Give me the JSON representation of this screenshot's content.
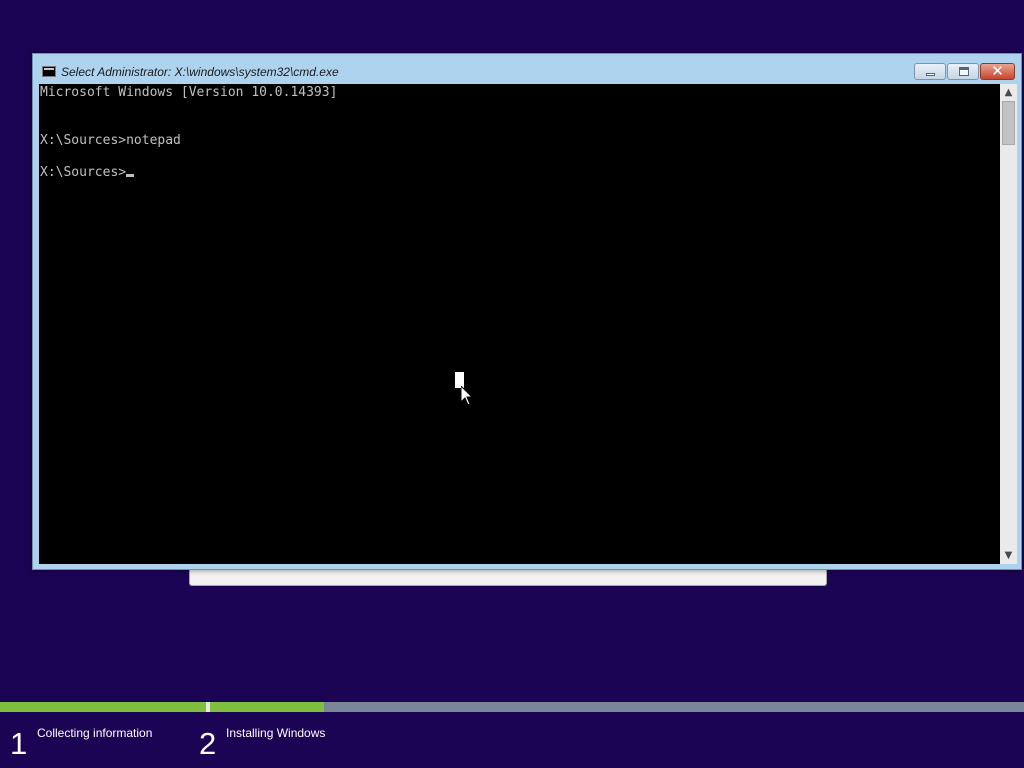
{
  "window": {
    "title": "Select Administrator: X:\\windows\\system32\\cmd.exe",
    "icon": "cmd-icon",
    "controls": {
      "minimize": "minimize-icon",
      "maximize": "maximize-icon",
      "close_symbol": "✕"
    }
  },
  "console": {
    "lines": [
      "Microsoft Windows [Version 10.0.14393]",
      "X:\\Sources>notepad",
      "X:\\Sources>"
    ],
    "text_color": "#c0c0c0",
    "background": "#000000"
  },
  "scrollbar": {
    "up_symbol": "▲",
    "down_symbol": "▼"
  },
  "setup": {
    "progress": {
      "step1_fraction": 1.0,
      "step2_fraction": 0.14
    },
    "steps": [
      {
        "number": "1",
        "label": "Collecting information"
      },
      {
        "number": "2",
        "label": "Installing Windows"
      }
    ],
    "colors": {
      "background": "#1c0455",
      "progress_fill": "#7fbf3e"
    }
  }
}
